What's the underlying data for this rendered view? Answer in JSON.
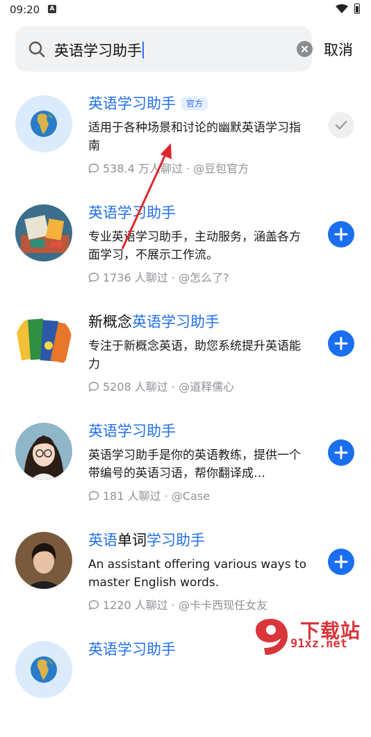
{
  "status": {
    "time": "09:20",
    "notification_icon": "A"
  },
  "search": {
    "query": "英语学习助手",
    "cancel_label": "取消"
  },
  "results": [
    {
      "avatar": "globe",
      "title_parts": [
        {
          "t": "英语学习助手",
          "hl": true
        }
      ],
      "badge": "官方",
      "description": "适用于各种场景和讨论的幽默英语学习指南",
      "chats": "538.4 万人聊过",
      "author": "@豆包官方",
      "action": "added"
    },
    {
      "avatar": "study-desk",
      "title_parts": [
        {
          "t": "英语学习助手",
          "hl": true
        }
      ],
      "badge": "",
      "description": "专业英语学习助手，主动服务，涵盖各方面学习，不展示工作流。",
      "chats": "1736 人聊过",
      "author": "@怎么了?",
      "action": "add"
    },
    {
      "avatar": "books",
      "title_parts": [
        {
          "t": "新概念",
          "hl": false
        },
        {
          "t": "英语学习助手",
          "hl": true
        }
      ],
      "badge": "",
      "description": "专注于新概念英语，助您系统提升英语能力",
      "chats": "5208 人聊过",
      "author": "@道释儒心",
      "action": "add"
    },
    {
      "avatar": "girl-portrait",
      "title_parts": [
        {
          "t": "英语学习助手",
          "hl": true
        }
      ],
      "badge": "",
      "description": "英语学习助手是你的英语教练，提供一个带编号的英语习语，帮你翻译成…",
      "chats": "181 人聊过",
      "author": "@Case",
      "action": "add"
    },
    {
      "avatar": "boy-portrait",
      "title_parts": [
        {
          "t": "英语",
          "hl": true
        },
        {
          "t": "单词",
          "hl": false
        },
        {
          "t": "学习助手",
          "hl": true
        }
      ],
      "badge": "",
      "description": "An assistant offering various ways to master English words.",
      "chats": "1220 人聊过",
      "author": "@卡卡西现任女友",
      "action": "add"
    },
    {
      "avatar": "globe",
      "title_parts": [
        {
          "t": "英语学习助手",
          "hl": true
        }
      ],
      "badge": "",
      "description": "",
      "chats": "",
      "author": "",
      "action": ""
    }
  ],
  "separator": "·",
  "watermark": {
    "brand": "下载站",
    "site": "91xz.net"
  },
  "colors": {
    "accent": "#1f6fe8",
    "annotation_arrow": "#e0262b"
  }
}
